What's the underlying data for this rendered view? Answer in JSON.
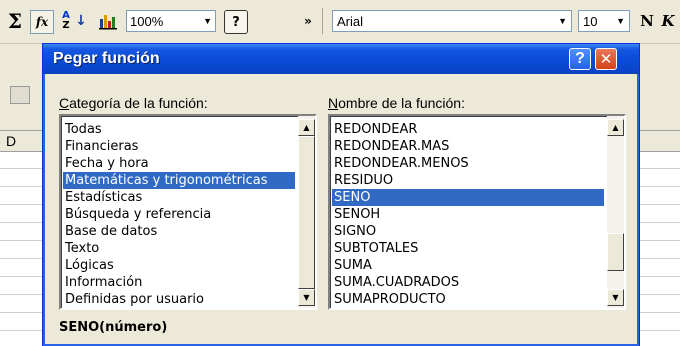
{
  "excel_toolbar": {
    "zoom": "100%",
    "font_name": "Arial",
    "font_size": "10",
    "bold_label": "N",
    "italic_label": "K",
    "column_header": "D"
  },
  "dialog": {
    "title": "Pegar función",
    "category_label_first": "C",
    "category_label_rest": "ategoría de la función:",
    "name_label_first": "N",
    "name_label_rest": "ombre de la función:",
    "categories": [
      "Todas",
      "Financieras",
      "Fecha y hora",
      "Matemáticas y trigonométricas",
      "Estadísticas",
      "Búsqueda y referencia",
      "Base de datos",
      "Texto",
      "Lógicas",
      "Información",
      "Definidas por usuario"
    ],
    "selected_category": "Matemáticas y trigonométricas",
    "functions": [
      "REDONDEAR",
      "REDONDEAR.MAS",
      "REDONDEAR.MENOS",
      "RESIDUO",
      "SENO",
      "SENOH",
      "SIGNO",
      "SUBTOTALES",
      "SUMA",
      "SUMA.CUADRADOS",
      "SUMAPRODUCTO"
    ],
    "selected_function": "SENO",
    "syntax": "SENO(número)",
    "help_button": "?",
    "close_button": "✕"
  }
}
